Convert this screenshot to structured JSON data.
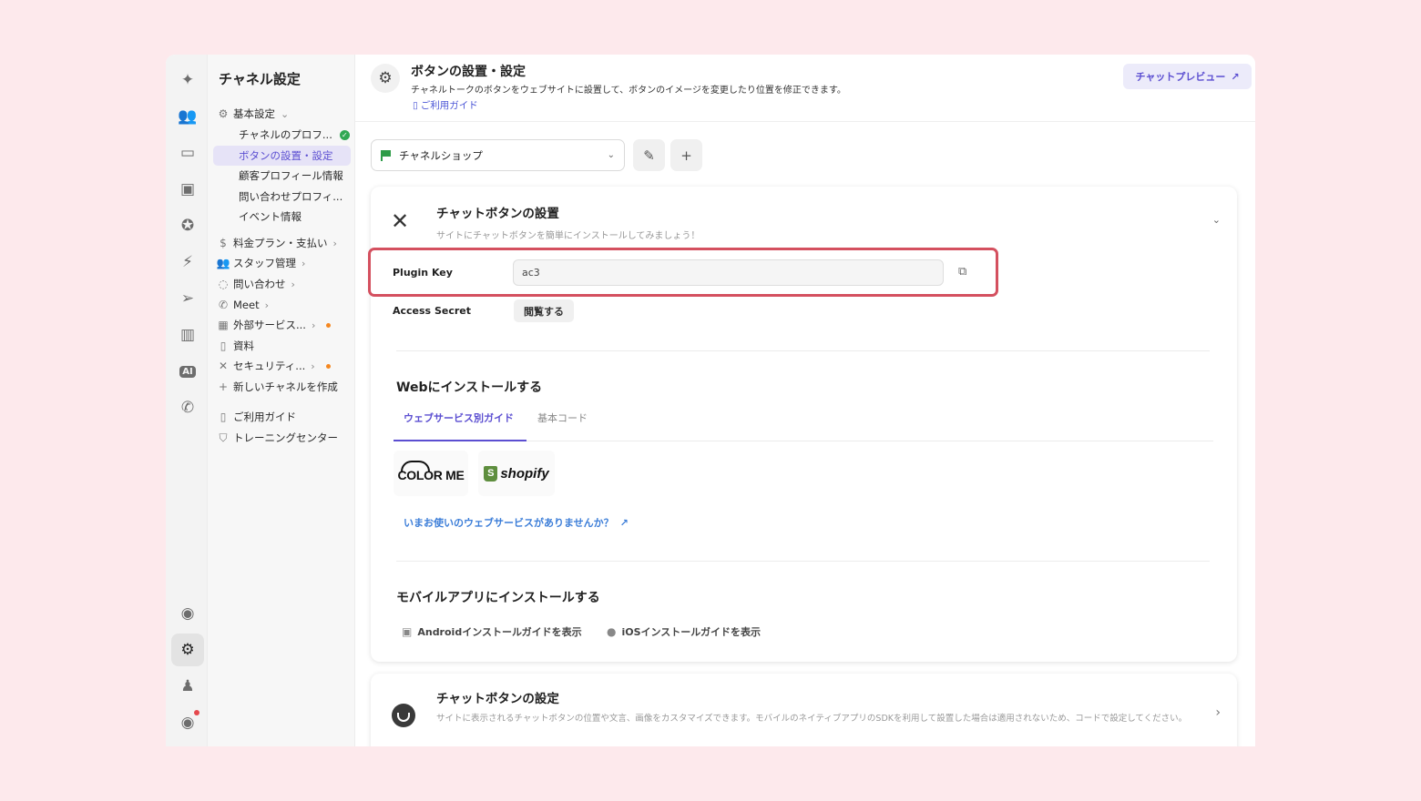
{
  "rail": {
    "items": [
      {
        "icon": "sparkle-icon",
        "glyph": "✦"
      },
      {
        "icon": "users-icon",
        "glyph": "👥"
      },
      {
        "icon": "inbox-icon",
        "glyph": "▭"
      },
      {
        "icon": "contact-card-icon",
        "glyph": "▣"
      },
      {
        "icon": "badge-check-icon",
        "glyph": "✪"
      },
      {
        "icon": "bolt-icon",
        "glyph": "⚡"
      },
      {
        "icon": "send-icon",
        "glyph": "➢"
      },
      {
        "icon": "book-icon",
        "glyph": "▥"
      },
      {
        "icon": "ai-icon",
        "glyph": "AI"
      },
      {
        "icon": "phone-icon",
        "glyph": "✆"
      }
    ],
    "bottom": [
      {
        "icon": "chat-icon",
        "glyph": "◉"
      },
      {
        "icon": "settings-icon",
        "glyph": "⚙"
      },
      {
        "icon": "user-avatar-icon",
        "glyph": "♟"
      },
      {
        "icon": "channel-talk-icon",
        "glyph": "◉"
      }
    ]
  },
  "sidebar": {
    "title": "チャネル設定",
    "items": [
      {
        "label": "基本設定",
        "icon": "⚙",
        "chevron": "⌄"
      },
      {
        "label": "チャネルのプロフ...",
        "status": "✓"
      },
      {
        "label": "ボタンの設置・設定"
      },
      {
        "label": "顧客プロフィール情報"
      },
      {
        "label": "問い合わせプロフィ..."
      },
      {
        "label": "イベント情報"
      },
      {
        "label": "料金プラン・支払い",
        "icon": "$",
        "chevron": "›"
      },
      {
        "label": "スタッフ管理",
        "icon": "👥",
        "chevron": "›"
      },
      {
        "label": "問い合わせ",
        "icon": "◌",
        "chevron": "›"
      },
      {
        "label": "Meet",
        "icon": "✆",
        "chevron": "›"
      },
      {
        "label": "外部サービス...",
        "icon": "▦",
        "chevron": "›"
      },
      {
        "label": "資料",
        "icon": "▯"
      },
      {
        "label": "セキュリティ...",
        "icon": "✕",
        "chevron": "›"
      },
      {
        "label": "新しいチャネルを作成",
        "icon": "+"
      },
      {
        "label": "ご利用ガイド",
        "icon": "▯"
      },
      {
        "label": "トレーニングセンター",
        "icon": "⛉"
      }
    ]
  },
  "header": {
    "icon": "⚙",
    "title": "ボタンの設置・設定",
    "description": "チャネルトークのボタンをウェブサイトに設置して、ボタンのイメージを変更したり位置を修正できます。",
    "guide_icon": "▯",
    "guide": "ご利用ガイド",
    "preview": "チャットプレビュー",
    "preview_icon": "↗"
  },
  "channel_select": {
    "value": "チャネルショップ",
    "caret": "⌄"
  },
  "toolbar": {
    "edit_icon": "✎",
    "add_icon": "+"
  },
  "install_card": {
    "icon": "✕",
    "title": "チャットボタンの設置",
    "subtitle": "サイトにチャットボタンを簡単にインストールしてみましょう！",
    "collapse_icon": "⌄",
    "plugin_key_label": "Plugin Key",
    "plugin_key_value": "ac3",
    "copy_icon": "⧉",
    "access_secret_label": "Access Secret",
    "view_button": "閲覧する",
    "web_title": "Webにインストールする",
    "tabs": [
      "ウェブサービス別ガイド",
      "基本コード"
    ],
    "services": [
      "COLOR ME",
      "shopify"
    ],
    "shopify_bag": "S",
    "no_service_link": "いまお使いのウェブサービスがありませんか？",
    "ext_icon": "↗",
    "mobile_title": "モバイルアプリにインストールする",
    "android_icon": "▣",
    "android_link": "Androidインストールガイドを表示",
    "ios_icon": "●",
    "ios_link": "iOSインストールガイドを表示"
  },
  "settings_card": {
    "title": "チャットボタンの設定",
    "description": "サイトに表示されるチャットボタンの位置や文言、画像をカスタマイズできます。モバイルのネイティブアプリのSDKを利用して設置した場合は適用されないため、コードで設定してください。",
    "chevron": "›"
  },
  "colors": {
    "accent": "#5b4ed1",
    "highlight": "#d4505f",
    "link": "#3b7dd8",
    "ok": "#31a853",
    "alert": "#f5871f"
  }
}
